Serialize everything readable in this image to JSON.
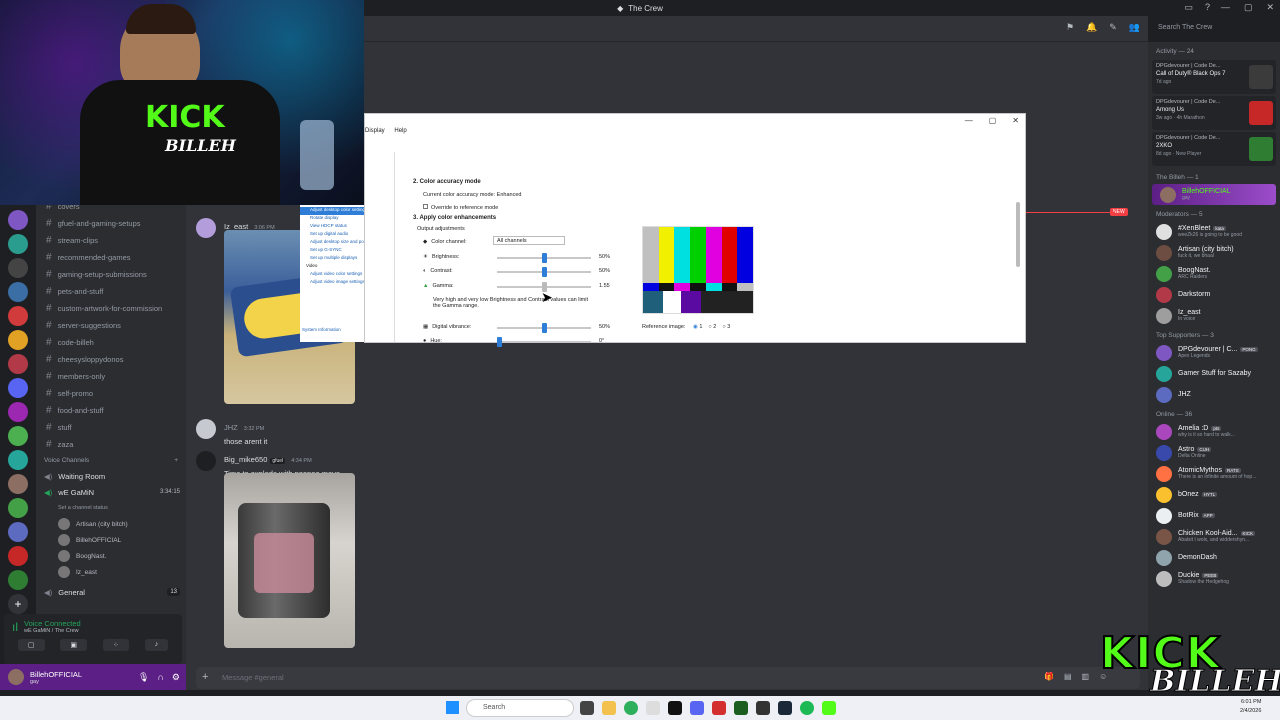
{
  "app": {
    "title": "The Crew",
    "search_placeholder": "Search The Crew"
  },
  "channels": [
    {
      "name": "covers"
    },
    {
      "name": "gfuel-and-gaming-setups"
    },
    {
      "name": "stream-clips"
    },
    {
      "name": "recommended-games"
    },
    {
      "name": "gaming-setup-submissions"
    },
    {
      "name": "pets-and-stuff"
    },
    {
      "name": "custom-artwork-for-commission"
    },
    {
      "name": "server-suggestions"
    },
    {
      "name": "code-billeh"
    },
    {
      "name": "cheesysloppydonos"
    },
    {
      "name": "members-only"
    },
    {
      "name": "self-promo"
    },
    {
      "name": "food-and-stuff"
    },
    {
      "name": "stuff"
    },
    {
      "name": "zaza"
    }
  ],
  "voice": {
    "section_title": "Voice Channels",
    "waiting_room": "Waiting Room",
    "active_channel": "wE GaMiN",
    "active_timer": "3:34:15",
    "status_placeholder": "Set a channel status",
    "users": [
      "Artisan (city bitch)",
      "BillehOFFICIAL",
      "BoogNast.",
      "Iz_east"
    ],
    "general": "General",
    "general_count": "13",
    "connected_label": "Voice Connected",
    "connected_sub": "wE GaMiN / The Crew"
  },
  "user_panel": {
    "name": "BillehOFFICIAL",
    "status": "gay"
  },
  "messages": [
    {
      "author": "Iz_east",
      "time": "3:06 PM",
      "text": ""
    },
    {
      "author": "JHZ",
      "time": "3:32 PM",
      "text": "those arent it"
    },
    {
      "author": "Big_mike650",
      "tag": "gfuel",
      "time": "4:34 PM",
      "text": "Time to explode with peepee mayo"
    }
  ],
  "composer": {
    "placeholder": "Message #general"
  },
  "new_badge": "NEW",
  "activity": {
    "title": "Activity — 24",
    "items": [
      {
        "user": "DPGdevourer | Code De...",
        "game": "Call of Duty® Black Ops 7",
        "meta": "7d ago"
      },
      {
        "user": "DPGdevourer | Code De...",
        "game": "Among Us",
        "meta": "3w ago · 4h Marathon"
      },
      {
        "user": "DPGdevourer | Code De...",
        "game": "2XKO",
        "meta": "8d ago · New Player"
      }
    ]
  },
  "members": {
    "billeh_title": "The Billeh — 1",
    "billeh": [
      {
        "name": "BillehOFFICIAL",
        "sub": "gay"
      }
    ],
    "mods_title": "Moderators — 5",
    "mods": [
      {
        "name": "#XenBleet",
        "tag": "kata",
        "sub": "weeZk26 is going to be good"
      },
      {
        "name": "Artisan (city bitch)",
        "sub": "fuck it, we bhaal"
      },
      {
        "name": "BoogNast.",
        "sub": "ARC Raiders"
      },
      {
        "name": "Darkstorm",
        "sub": ""
      },
      {
        "name": "Iz_east",
        "sub": "In voice"
      }
    ],
    "supporters_title": "Top Supporters — 3",
    "supporters": [
      {
        "name": "DPGdevourer | C...",
        "tag": "PONG",
        "sub": "Apex Legends"
      },
      {
        "name": "Gamer Stuff for Sazaby",
        "sub": ""
      },
      {
        "name": "JHZ",
        "sub": ""
      }
    ],
    "online_title": "Online — 36",
    "online": [
      {
        "name": "Amelia :D",
        "tag": "pts",
        "sub": "why is it so hard to walk..."
      },
      {
        "name": "Astro",
        "tag": "CUH",
        "sub": "Delta Online"
      },
      {
        "name": "AtomicMythos",
        "tag": "RATS",
        "sub": "There is an infinite amount of hop..."
      },
      {
        "name": "bOnez",
        "tag": "HYTL",
        "sub": ""
      },
      {
        "name": "BotRix",
        "tag": "APP",
        "sub": ""
      },
      {
        "name": "Chicken Kool-Aid...",
        "tag": "KICK",
        "sub": "Abalsit I wolx, and widdershyn..."
      },
      {
        "name": "DemonDash",
        "sub": ""
      },
      {
        "name": "Duckie",
        "tag": "PEEB",
        "sub": "Shadow the Hedgehog"
      }
    ]
  },
  "dialog": {
    "menu_display": "Display",
    "menu_help": "Help",
    "section2": "2. Color accuracy mode",
    "current_mode": "Current color accuracy mode: Enhanced",
    "override": "Override to reference mode",
    "section3": "3. Apply color enhancements",
    "output_adj": "Output adjustments",
    "color_channel": "Color channel:",
    "all_channels": "All channels",
    "brightness": "Brightness:",
    "brightness_val": "50%",
    "contrast": "Contrast:",
    "contrast_val": "50%",
    "gamma": "Gamma:",
    "gamma_val": "1.55",
    "warning": "Very high and very low Brightness and Contrast values can limit the Gamma range.",
    "digital_vibrance": "Digital vibrance:",
    "digital_vibrance_val": "50%",
    "hue": "Hue:",
    "hue_val": "0°",
    "reference_image": "Reference image:",
    "ref_options": [
      "1",
      "2",
      "3"
    ],
    "brightness_level": 0.5,
    "contrast_level": 0.5,
    "gamma_level": 0.5,
    "vibrance_level": 0.5,
    "hue_level": 0.0
  },
  "nav_pane": {
    "items": [
      "Adjust desktop color settings",
      "Rotate display",
      "View HDCP status",
      "Set up digital audio",
      "Adjust desktop size and position",
      "Set up G-SYNC",
      "Set up multiple displays"
    ],
    "video_title": "Video",
    "video_items": [
      "Adjust video color settings",
      "Adjust video image settings"
    ],
    "system_info": "System Information"
  },
  "taskbar": {
    "search": "Search",
    "time": "6:01 PM",
    "date": "2/4/2026"
  },
  "overlay": {
    "kick": "KICK",
    "billeh": "BILLEH",
    "shirt_kick": "KICK",
    "shirt_billeh": "BILLEH"
  }
}
